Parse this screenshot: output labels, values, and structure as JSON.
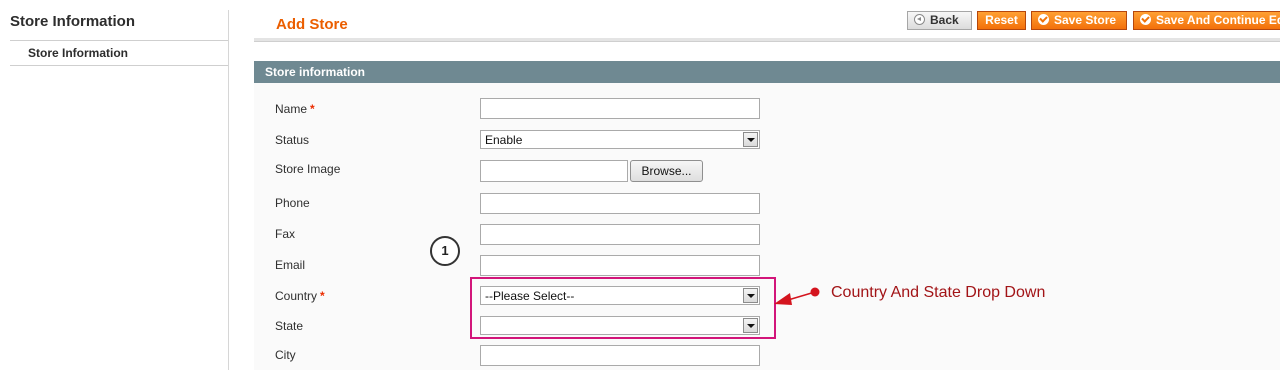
{
  "sidebar": {
    "title": "Store Information",
    "items": [
      {
        "label": "Store Information"
      }
    ]
  },
  "header": {
    "title": "Add Store",
    "buttons": {
      "back": "Back",
      "reset": "Reset",
      "save": "Save Store",
      "save_continue": "Save And Continue Ed"
    }
  },
  "section": {
    "title": "Store information"
  },
  "form": {
    "name": {
      "label": "Name",
      "value": ""
    },
    "status": {
      "label": "Status",
      "selected": "Enable"
    },
    "store_image": {
      "label": "Store Image",
      "value": "",
      "browse_label": "Browse..."
    },
    "phone": {
      "label": "Phone",
      "value": ""
    },
    "fax": {
      "label": "Fax",
      "value": ""
    },
    "email": {
      "label": "Email",
      "value": ""
    },
    "country": {
      "label": "Country",
      "selected": "--Please Select--"
    },
    "state": {
      "label": "State",
      "selected": ""
    },
    "city": {
      "label": "City",
      "value": ""
    },
    "required_marker": "*"
  },
  "annotations": {
    "step_number": "1",
    "callout": "Country And State Drop Down",
    "highlight_color": "#d2157a",
    "callout_color": "#a21417"
  },
  "colors": {
    "accent_orange": "#eb5e00",
    "section_bar": "#6f8992"
  }
}
